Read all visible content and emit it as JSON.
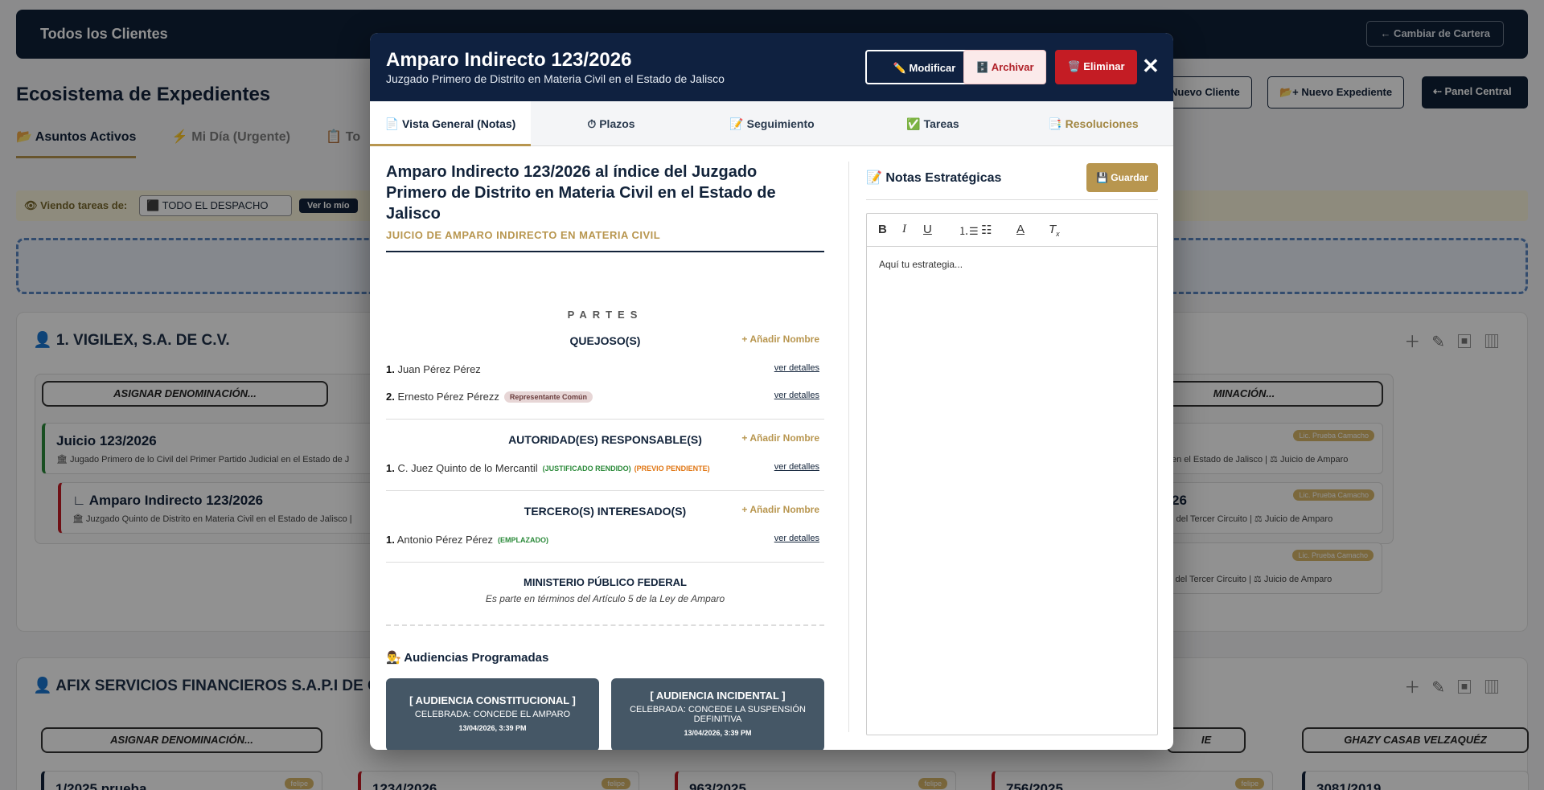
{
  "background": {
    "topbar_title": "Todos los Clientes",
    "change_portfolio": "← Cambiar de Cartera",
    "page_title": "Ecosistema de Expedientes",
    "new_client": "Nuevo Cliente",
    "new_file": "📂+ Nuevo Expediente",
    "central_panel": "⇠ Panel Central",
    "tabs": [
      "📂 Asuntos Activos",
      "⚡ Mi Día (Urgente)",
      "📋 To"
    ],
    "filter_label": "👁 Viendo tareas de:",
    "filter_value": "⬛ TODO EL DESPACHO",
    "see_mine": "Ver lo mío",
    "client1": "👤 1. VIGILEX, S.A. DE C.V.",
    "client2": "👤 AFIX SERVICIOS FINANCIEROS S.A.P.I DE C.V.;",
    "assign": "ASIGNAR DENOMINACIÓN...",
    "assign_right": "MINACIÓN...",
    "exp1_title": "Juicio 123/2026",
    "exp1_sub": "🏛 Jugado Primero de lo Civil del Primer Partido Judicial en el Estado de J",
    "exp2_title": "∟ Amparo Indirecto 123/2026",
    "exp2_sub": "🏛 Juzgado Quinto de Distrito en Materia Civil en el Estado de Jalisco |",
    "right_exp1": "en el Estado de Jalisco | ⚖ Juicio de Amparo",
    "right_exp2_title": "26",
    "right_exp2": "l del Tercer Circuito | ⚖ Juicio de Amparo",
    "right_exp3": "l del Tercer Circuito | ⚖ Juicio de Amparo",
    "lic": "Lic. Prueba Camacho",
    "row2_pills": [
      "ASIGNAR DENOMINACIÓN...",
      "IE",
      "GHAZY CASAB VELZAQUÉZ"
    ],
    "row2_exps": [
      "1/2025 prueba",
      "1234/2026",
      "963/2025",
      "756/2025",
      "3081/2019"
    ],
    "felipe": "felipe"
  },
  "modal": {
    "title": "Amparo Indirecto 123/2026",
    "subtitle": "Juzgado Primero de Distrito en Materia Civil en el Estado de Jalisco",
    "btn_modify": "✏️ Modificar",
    "btn_archive": "🗄️ Archivar",
    "btn_delete": "🗑️ Eliminar",
    "close": "✕",
    "tabs": [
      "📄 Vista General (Notas)",
      "⏱ Plazos",
      "📝 Seguimiento",
      "✅ Tareas",
      "📑 Resoluciones"
    ],
    "case_title": "Amparo Indirecto 123/2026 al índice del Juzgado Primero de Distrito en Materia Civil en el Estado de Jalisco",
    "case_type": "JUICIO DE AMPARO INDIRECTO EN MATERIA CIVIL",
    "parties_heading": "PARTES",
    "add_name": "+ Añadir Nombre",
    "see_details": "ver detalles",
    "quejosos": {
      "heading": "QUEJOSO(S)",
      "items": [
        {
          "num": "1.",
          "name": "Juan Pérez Pérez"
        },
        {
          "num": "2.",
          "name": "Ernesto Pérez Pérezz",
          "tag": "Representante Común"
        }
      ]
    },
    "autoridades": {
      "heading": "AUTORIDAD(ES) RESPONSABLE(S)",
      "items": [
        {
          "num": "1.",
          "name": "C. Juez Quinto de lo Mercantil",
          "tag_green": "(JUSTIFICADO RENDIDO)",
          "tag_orange": "(PREVIO PENDIENTE)"
        }
      ]
    },
    "terceros": {
      "heading": "TERCERO(S) INTERESADO(S)",
      "items": [
        {
          "num": "1.",
          "name": "Antonio Pérez Pérez",
          "tag_green": "(EMPLAZADO)"
        }
      ]
    },
    "mp_title": "MINISTERIO PÚBLICO FEDERAL",
    "mp_desc": "Es parte en términos del Artículo 5 de la Ley de Amparo",
    "hearings_title": "👨‍⚖️ Audiencias Programadas",
    "hearings": [
      {
        "name": "[ AUDIENCIA CONSTITUCIONAL ]",
        "result": "CELEBRADA: CONCEDE EL AMPARO",
        "date": "13/04/2026, 3:39 PM"
      },
      {
        "name": "[ AUDIENCIA INCIDENTAL ]",
        "result": "CELEBRADA: CONCEDE LA SUSPENSIÓN DEFINITIVA",
        "date": "13/04/2026, 3:39 PM"
      }
    ],
    "notes_title": "📝 Notas Estratégicas",
    "save": "💾 Guardar",
    "editor_placeholder": "Aquí tu estrategia..."
  },
  "colors": {
    "navy": "#0f2140",
    "gold": "#b8964f",
    "danger": "#c41c24",
    "hearing": "#455766"
  }
}
